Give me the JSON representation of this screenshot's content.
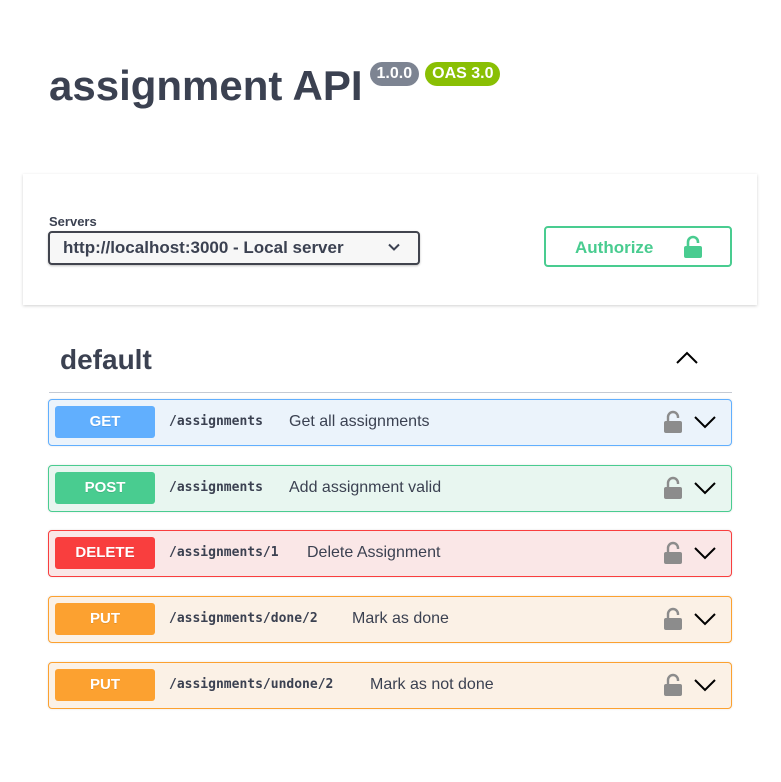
{
  "info": {
    "title": "assignment API",
    "version": "1.0.0",
    "oas": "OAS 3.0"
  },
  "servers": {
    "label": "Servers",
    "selected": "http://localhost:3000 - Local server"
  },
  "authorize": {
    "label": "Authorize",
    "icon": "unlocked-padlock-icon"
  },
  "tag": {
    "name": "default",
    "toggle_icon": "chevron-up-icon"
  },
  "operations": [
    {
      "method": "GET",
      "path": "/assignments",
      "summary": "Get all assignments",
      "color": "#61affe"
    },
    {
      "method": "POST",
      "path": "/assignments",
      "summary": "Add assignment valid",
      "color": "#49cc90"
    },
    {
      "method": "DELETE",
      "path": "/assignments/1",
      "summary": "Delete Assignment",
      "color": "#f93e3e"
    },
    {
      "method": "PUT",
      "path": "/assignments/done/2",
      "summary": "Mark as done",
      "color": "#fca130"
    },
    {
      "method": "PUT",
      "path": "/assignments/undone/2",
      "summary": "Mark as not done",
      "color": "#fca130"
    }
  ],
  "colors": {
    "text": "#3b4151",
    "version_badge": "#7d8492",
    "oas_badge": "#89bf04",
    "authorize": "#49cc90"
  }
}
